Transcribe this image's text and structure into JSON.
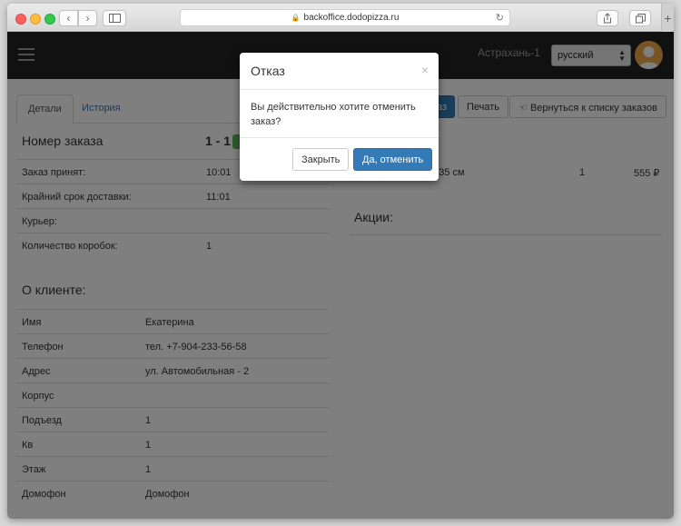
{
  "browser": {
    "url": "backoffice.dodopizza.ru",
    "new_tab_glyph": "+"
  },
  "navbar": {
    "city": "Астрахань-1",
    "language": "русский"
  },
  "tabs": [
    {
      "label": "Детали"
    },
    {
      "label": "История"
    }
  ],
  "actions": {
    "cancel_fragment": "аз",
    "print": "Печать",
    "back_to_list": "Вернуться к списку заказов"
  },
  "order": {
    "title": "Номер заказа",
    "number": "1 - 1",
    "fields": [
      {
        "label": "Заказ принят:",
        "value": "10:01"
      },
      {
        "label": "Крайний срок доставки:",
        "value": "11:01"
      },
      {
        "label": "Курьер:",
        "value": ""
      },
      {
        "label": "Количество коробок:",
        "value": "1"
      }
    ]
  },
  "client": {
    "title": "О клиенте:",
    "fields": [
      {
        "label": "Имя",
        "value": "Екатерина"
      },
      {
        "label": "Телефон",
        "value": "тел. +7-904-233-56-58"
      },
      {
        "label": "Адрес",
        "value": "ул. Автомобильная - 2"
      },
      {
        "label": "Корпус",
        "value": ""
      },
      {
        "label": "Подъезд",
        "value": "1"
      },
      {
        "label": "Кв",
        "value": "1"
      },
      {
        "label": "Этаж",
        "value": "1"
      },
      {
        "label": "Домофон",
        "value": "Домофон"
      }
    ]
  },
  "order_items": [
    {
      "product": "и 35 см",
      "qty": "1",
      "price": "555 ₽"
    }
  ],
  "promotions": {
    "title": "Акции:"
  },
  "modal": {
    "title": "Отказ",
    "close_glyph": "×",
    "message": "Вы действительно хотите отменить заказ?",
    "close_button": "Закрыть",
    "confirm_button": "Да, отменить"
  },
  "colors": {
    "primary": "#337ab7",
    "navbar": "#222222",
    "success": "#5cb85c"
  }
}
